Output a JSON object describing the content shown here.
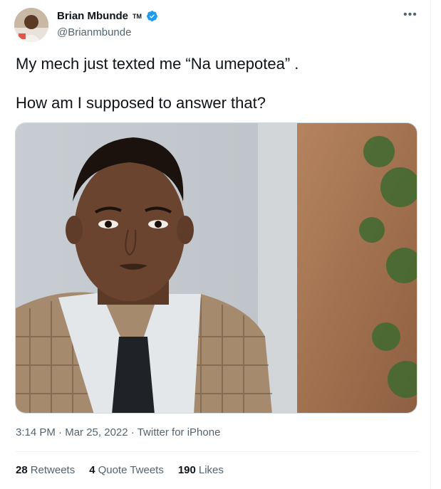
{
  "author": {
    "name": "Brian Mbunde",
    "trademark": "TM",
    "handle": "@Brianmbunde",
    "verified_color": "#1d9bf0"
  },
  "more_icon": "•••",
  "tweet": {
    "line1": "My mech just texted me “Na umepotea” .",
    "line2": "How am I supposed to answer that?"
  },
  "media": {
    "description_icon": "photo"
  },
  "meta": {
    "time": "3:14 PM",
    "date": "Mar 25, 2022",
    "source": "Twitter for iPhone",
    "separator": "·"
  },
  "stats": {
    "retweets_count": "28",
    "retweets_label": "Retweets",
    "quotes_count": "4",
    "quotes_label": "Quote Tweets",
    "likes_count": "190",
    "likes_label": "Likes"
  }
}
